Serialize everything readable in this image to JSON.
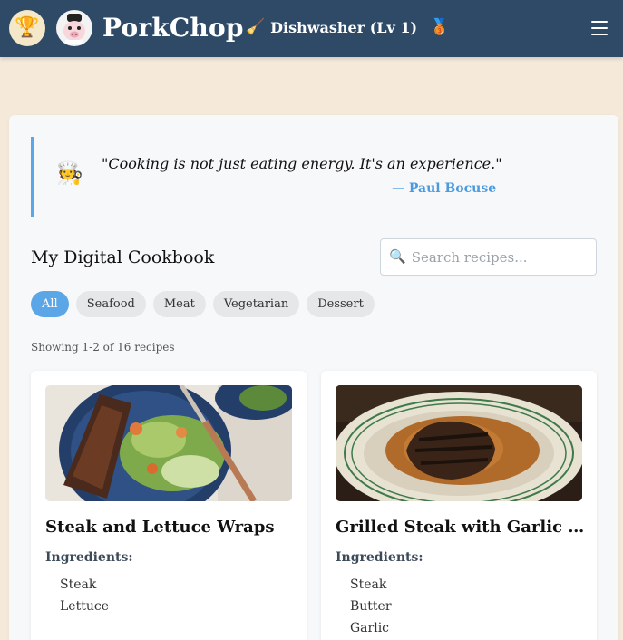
{
  "header": {
    "brand": "PorkChop",
    "rank_label": "Dishwasher (Lv 1)",
    "icons": [
      "trophy-icon",
      "avatar-icon",
      "broom-icon",
      "medal-icon",
      "menu-icon"
    ]
  },
  "quote": {
    "text": "\"Cooking is not just eating energy. It's an experience.\"",
    "author": "— Paul Bocuse"
  },
  "cookbook": {
    "title": "My Digital Cookbook",
    "search_placeholder": "Search recipes...",
    "filters": [
      {
        "label": "All",
        "active": true
      },
      {
        "label": "Seafood",
        "active": false
      },
      {
        "label": "Meat",
        "active": false
      },
      {
        "label": "Vegetarian",
        "active": false
      },
      {
        "label": "Dessert",
        "active": false
      }
    ],
    "count_text": "Showing 1-2 of 16 recipes",
    "ingredients_label": "Ingredients:",
    "recipes": [
      {
        "title": "Steak and Lettuce Wraps",
        "ingredients": [
          "Steak",
          "Lettuce"
        ]
      },
      {
        "title": "Grilled Steak with Garlic Herb Butter",
        "ingredients": [
          "Steak",
          "Butter",
          "Garlic"
        ]
      }
    ]
  },
  "colors": {
    "header_bg": "#2e4a66",
    "accent": "#5aa6e6",
    "page_bg": "#f5e9d9"
  }
}
